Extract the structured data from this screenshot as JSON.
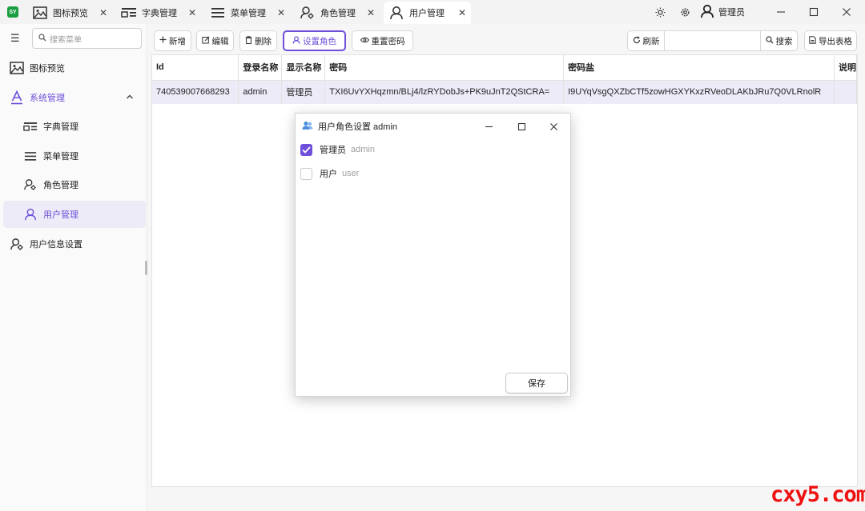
{
  "app": {
    "logo_text": "SY"
  },
  "tabs": [
    {
      "label": "图标预览",
      "icon": "image-icon"
    },
    {
      "label": "字典管理",
      "icon": "dictionary-icon"
    },
    {
      "label": "菜单管理",
      "icon": "menu-icon"
    },
    {
      "label": "角色管理",
      "icon": "role-icon"
    },
    {
      "label": "用户管理",
      "icon": "user-icon",
      "active": true
    }
  ],
  "header": {
    "user_name": "管理员"
  },
  "sidebar": {
    "search_placeholder": "搜索菜单",
    "items": [
      {
        "label": "图标预览",
        "icon": "image-icon"
      },
      {
        "label": "系统管理",
        "icon": "font-a-icon",
        "expanded": true
      },
      {
        "label": "字典管理",
        "icon": "dictionary-icon"
      },
      {
        "label": "菜单管理",
        "icon": "menu-icon"
      },
      {
        "label": "角色管理",
        "icon": "role-icon"
      },
      {
        "label": "用户管理",
        "icon": "user-icon",
        "active": true
      },
      {
        "label": "用户信息设置",
        "icon": "user-settings-icon"
      }
    ]
  },
  "toolbar": {
    "add": "新增",
    "edit": "编辑",
    "delete": "删除",
    "set_role": "设置角色",
    "reset_password": "重置密码",
    "refresh": "刷新",
    "search_value": "",
    "search": "搜索",
    "export": "导出表格"
  },
  "table": {
    "headers": [
      "Id",
      "登录名称",
      "显示名称",
      "密码",
      "密码盐",
      "说明"
    ],
    "rows": [
      [
        "740539007668293",
        "admin",
        "管理员",
        "TXI6UvYXHqzmn/BLj4/lzRYDobJs+PK9uJnT2QStCRA=",
        "I9UYqVsgQXZbCTf5zowHGXYKxzRVeoDLAKbJRu7Q0VLRnolR",
        ""
      ]
    ]
  },
  "dialog": {
    "title": "用户角色设置 admin",
    "roles": [
      {
        "name": "管理员",
        "code": "admin",
        "checked": true
      },
      {
        "name": "用户",
        "code": "user",
        "checked": false
      }
    ],
    "save": "保存"
  },
  "watermark": "cxy5.com",
  "colors": {
    "accent": "#6e4fd9",
    "selected_row": "#eeebf8",
    "watermark": "#ee1111"
  }
}
